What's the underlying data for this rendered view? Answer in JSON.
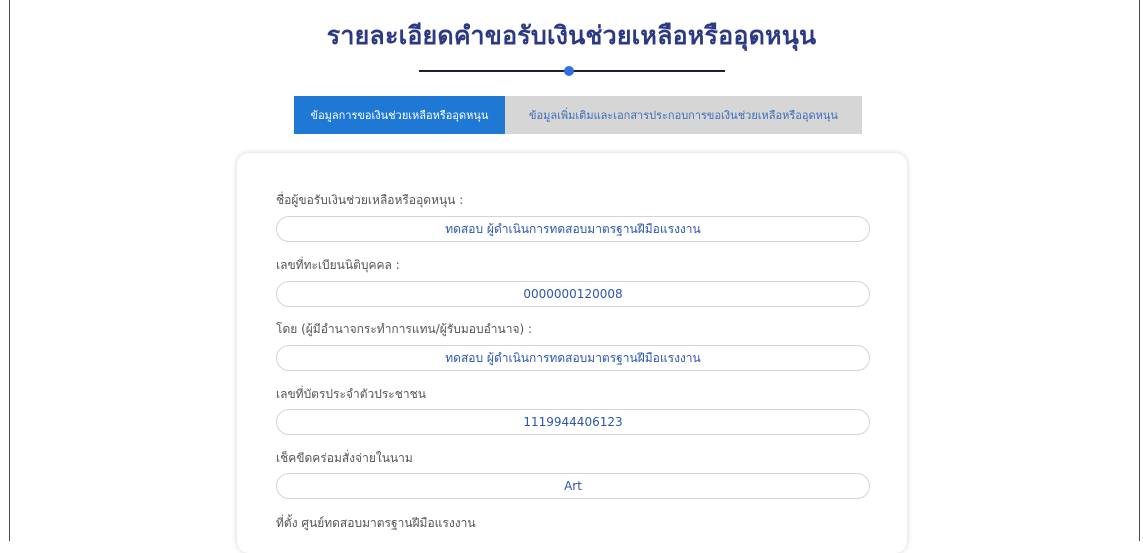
{
  "page": {
    "title": "รายละเอียดคำขอรับเงินช่วยเหลือหรืออุดหนุน"
  },
  "tabs": [
    {
      "label": "ข้อมูลการขอเงินช่วยเหลือหรืออุดหนุน",
      "active": true
    },
    {
      "label": "ข้อมูลเพิ่มเติมและเอกสารประกอบการขอเงินช่วยเหลือหรืออุดหนุน",
      "active": false
    }
  ],
  "form": {
    "fields": [
      {
        "label": "ชื่อผู้ขอรับเงินช่วยเหลือหรืออุดหนุน :",
        "value": "ทดสอบ ผู้ดำเนินการทดสอบมาตรฐานฝีมือแรงงาน"
      },
      {
        "label": "เลขที่ทะเบียนนิติบุคคล :",
        "value": "0000000120008"
      },
      {
        "label": "โดย (ผู้มีอำนาจกระทำการแทน/ผู้รับมอบอำนาจ) :",
        "value": "ทดสอบ ผู้ดำเนินการทดสอบมาตรฐานฝีมือแรงงาน"
      },
      {
        "label": "เลขที่บัตรประจำตัวประชาชน",
        "value": "1119944406123"
      },
      {
        "label": "เช็คขีดคร่อมสั่งจ่ายในนาม",
        "value": "Art"
      },
      {
        "label": "ที่ตั้ง ศูนย์ทดสอบมาตรฐานฝีมือแรงงาน",
        "value": ""
      }
    ]
  },
  "colors": {
    "title": "#2c3a85",
    "accent": "#1e78d4",
    "tab_inactive_bg": "#d6d6d6",
    "value_text": "#2c56b0"
  }
}
